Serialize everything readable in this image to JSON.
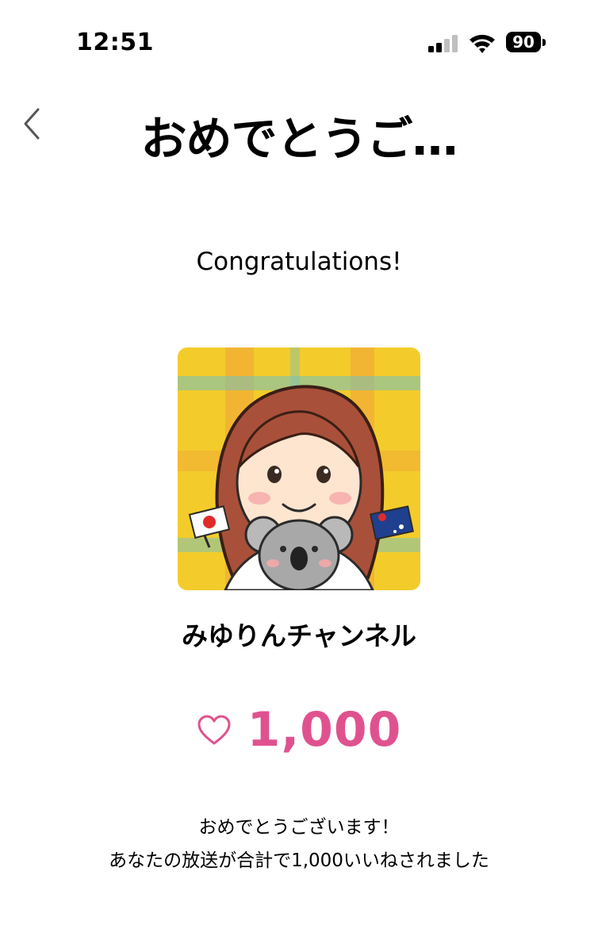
{
  "status_bar": {
    "time": "12:51",
    "battery_level": "90",
    "icons": [
      "signal-icon",
      "wifi-icon",
      "battery-icon"
    ]
  },
  "nav": {
    "title": "おめでとうご…",
    "back_icon": "chevron-left-icon"
  },
  "congrats_heading": "Congratulations!",
  "channel": {
    "name": "みゆりんチャンネル"
  },
  "likes": {
    "count": "1,000",
    "icon": "heart-outline-icon",
    "color": "#e0528f"
  },
  "message": {
    "line1": "おめでとうございます！",
    "line2": "あなたの放送が合計で1,000いいねされました"
  }
}
